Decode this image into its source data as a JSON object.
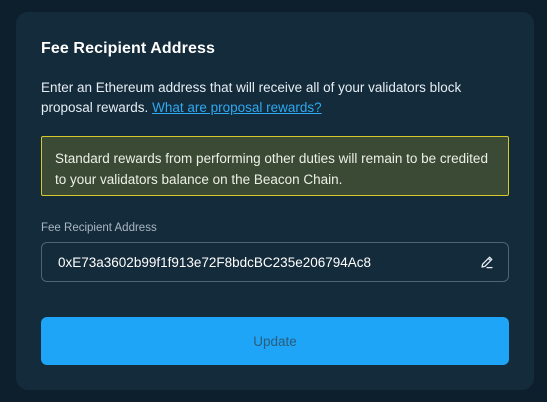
{
  "card": {
    "title": "Fee Recipient Address",
    "description": "Enter an Ethereum address that will receive all of your validators block proposal rewards.",
    "link_text": "What are proposal rewards?",
    "notice": "Standard rewards from performing other duties will remain to be credited to your validators balance on the Beacon Chain.",
    "field_label": "Fee Recipient Address",
    "address_value": "0xE73a3602b99f1f913e72F8bdcBC235e206794Ac8",
    "edit_icon": "pencil-icon",
    "update_label": "Update"
  },
  "colors": {
    "background": "#0d1f2d",
    "card": "#142b3b",
    "accent": "#1ea5f7",
    "link": "#2ea8f0",
    "notice_border": "#d8c92a",
    "notice_bg": "#3a4a35"
  }
}
